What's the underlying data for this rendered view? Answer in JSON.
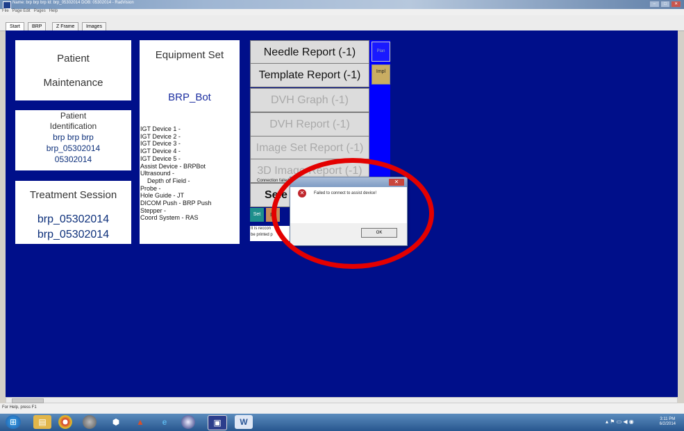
{
  "window": {
    "title": "Name: brp brp brp   Id: brp_05302014   DOB: 05302014 - RadVision",
    "controls": [
      "–",
      "□",
      "✕"
    ]
  },
  "menu": [
    "File",
    "Page Edit",
    "Pages",
    "Help"
  ],
  "tabs": [
    "Start",
    "BRP",
    "Z Frame",
    "Images"
  ],
  "patient_maintenance": {
    "line1": "Patient",
    "line2": "Maintenance"
  },
  "patient_identification": {
    "heading1": "Patient",
    "heading2": "Identification",
    "name": "brp brp brp",
    "id": "brp_05302014",
    "dob": "05302014"
  },
  "treatment_session": {
    "heading": "Treatment Session",
    "line1": "brp_05302014",
    "line2": "brp_05302014"
  },
  "equipment_set": {
    "heading": "Equipment Set",
    "name": "BRP_Bot",
    "details": [
      "IGT Device 1 -",
      "IGT Device 2 -",
      "IGT Device 3 -",
      "IGT Device 4 -",
      "IGT Device 5 -",
      "Assist Device - BRPBot",
      "Ultrasound -",
      "    Depth of Field -",
      "Probe -",
      "Hole Guide - JT",
      "DICOM Push - BRP Push",
      "Stepper -",
      "Coord System - RAS"
    ]
  },
  "reports": {
    "needle": "Needle Report (-1)",
    "template": "Template Report (-1)",
    "dvh_graph": "DVH Graph (-1)",
    "dvh_report": "DVH Report (-1)",
    "image_set": "Image Set Report (-1)",
    "image_3d": "3D Image Report (-1)",
    "select": "Sele",
    "plan_tag": "Plan",
    "impl_tag": "Impl",
    "set_btn": "Set",
    "ps_tag": "ps",
    "note1": "It is reccon",
    "note2": "be printed p"
  },
  "dialog": {
    "title": "Connection failed",
    "message": "Failed to connect to assist device!",
    "ok": "OK",
    "close": "✕"
  },
  "status": {
    "text": "For Help, press F1"
  },
  "taskbar": {
    "apps": [
      "windows-start-icon",
      "explorer-icon",
      "chrome-icon",
      "media-icon",
      "virtualbox-icon",
      "matlab-icon",
      "ie-icon",
      "browser-icon",
      "radvision-icon",
      "word-icon"
    ],
    "time": "3:11 PM",
    "date": "6/2/2014"
  },
  "colors": {
    "background": "#000f8a",
    "highlight_circle": "#e30000",
    "side_bar": "#0000ff"
  }
}
